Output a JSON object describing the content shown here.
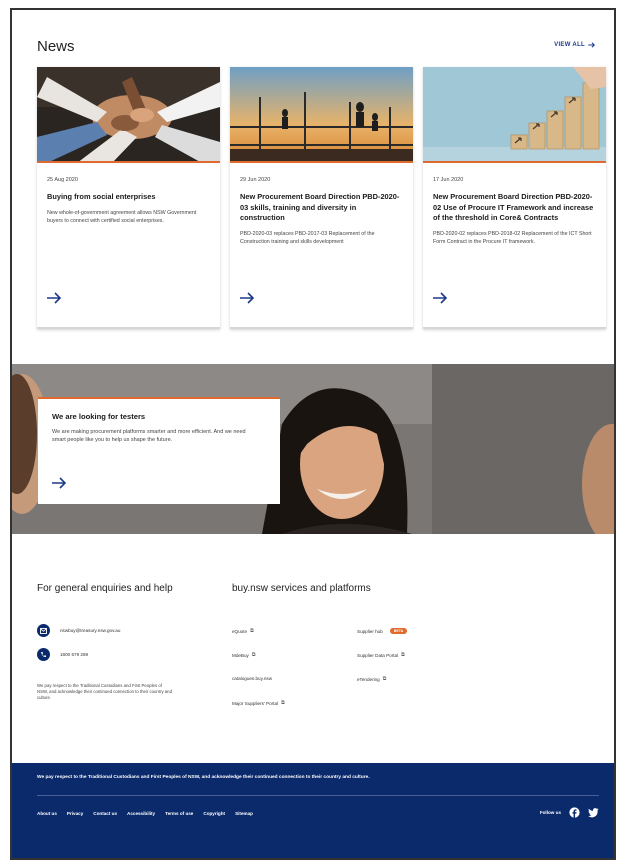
{
  "news": {
    "title": "News",
    "view_all": "VIEW ALL",
    "items": [
      {
        "date": "25 Aug 2020",
        "title": "Buying from social enterprises",
        "description": "New whole-of-government agreement allows NSW Government buyers to connect with certified social enterprises."
      },
      {
        "date": "29 Jun 2020",
        "title": "New Procurement Board Direction PBD-2020-03 skills, training and diversity in construction",
        "description": "PBD-2020-03 replaces PBD-2017-03 Replacement of the Construction training and skills development"
      },
      {
        "date": "17 Jun 2020",
        "title": "New Procurement Board Direction PBD-2020-02 Use of Procure IT Framework and increase of the threshold in Core& Contracts",
        "description": "PBD-2020-02 replaces PBD-2018-02 Replacement of the ICT Short Form Contract in the Procure IT framework."
      }
    ]
  },
  "testers": {
    "title": "We are looking for testers",
    "description": "We are making procurement platforms smarter and more efficient. And we need smart people like you to help us shape the future."
  },
  "enquiries": {
    "title": "For general enquiries and help",
    "email": "nswbuy@treasury.nsw.gov.au",
    "phone": "1800 679 289",
    "acknowledgement": "We pay respect to the Traditional Custodians and First Peoples of NSW, and acknowledge their continued connection to their country and culture."
  },
  "services": {
    "title": "buy.nsw services and platforms",
    "links": [
      {
        "label": "eQuote"
      },
      {
        "label": "MdeBuy"
      },
      {
        "label": "catalogues.buy.nsw"
      },
      {
        "label": "Major Suppliers' Portal"
      },
      {
        "label": "Supplier hub",
        "badge": "BETA"
      },
      {
        "label": "Supplier Data Portal"
      },
      {
        "label": "eTendering"
      }
    ]
  },
  "footer": {
    "acknowledgement": "We pay respect to the Traditional Custodians and First Peoples of NSW, and acknowledge their continued connection to their country and culture.",
    "links": [
      "About us",
      "Privacy",
      "Contact us",
      "Accessibility",
      "Terms of use",
      "Copyright",
      "Sitemap"
    ],
    "follow_label": "Follow us"
  },
  "colors": {
    "navy": "#0b2a6b",
    "accent_orange": "#e0692d",
    "link_blue": "#1b3a8c"
  }
}
